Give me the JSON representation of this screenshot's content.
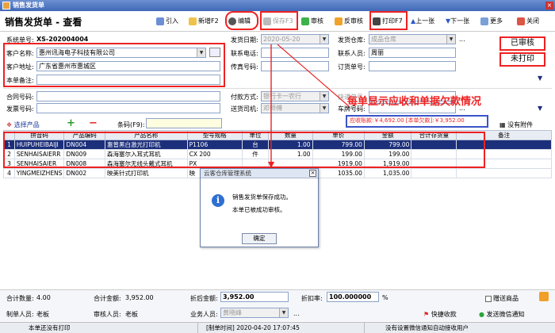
{
  "window": {
    "title": "销售发货单"
  },
  "header": {
    "page_title": "销售发货单 - 查看"
  },
  "toolbar": {
    "import": "引入",
    "new": "新增F2",
    "edit": "编辑",
    "save": "保存F3",
    "approve": "审核",
    "unapprove": "反审核",
    "print": "打印F7",
    "prev": "上一张",
    "next": "下一张",
    "more": "更多",
    "close": "关闭"
  },
  "form": {
    "sys_no_label": "系统单号:",
    "sys_no": "XS-202004004",
    "date_label": "发货日期:",
    "date": "2020-05-20",
    "warehouse_label": "发货仓库:",
    "warehouse": "成品仓库",
    "customer_label": "客户名称:",
    "customer": "惠州讯海电子科技有限公司",
    "contact_phone_label": "联系电话:",
    "contact_phone": "",
    "contact_label": "联系人员:",
    "contact": "周丽",
    "address_label": "客户地址:",
    "address": "广东省惠州市惠城区",
    "fax_label": "传真号码:",
    "fax": "",
    "order_label": "订货单号:",
    "order": "",
    "remark_label": "本单备注:",
    "remark": "",
    "contract_label": "合同号码:",
    "contract": "",
    "payment_label": "付款方式:",
    "payment": "银行卡一农行",
    "express_label": "快递单号:",
    "express": "",
    "invoice_label": "发票号码:",
    "invoice": "",
    "driver_label": "送货司机:",
    "driver": "邓师傅",
    "car_label": "车牌号码:",
    "car": ""
  },
  "status": {
    "approved": "已审核",
    "unprinted": "未打印"
  },
  "annotation": "每单显示应收和单据欠款情况",
  "receivable": "应收账款:￥4,692.00 [本单欠款]:￥3,952.00",
  "product_bar": {
    "select": "选择产品",
    "barcode_label": "条码(F9):",
    "barcode": "",
    "no_attach": "没有附件"
  },
  "table": {
    "headers": [
      "",
      "拼音码",
      "产品编码",
      "产品名称",
      "型号规格",
      "单位",
      "数量",
      "单价",
      "金额",
      "合计存货量",
      "备注"
    ],
    "rows": [
      [
        "1",
        "HUIPUHEIBAIJI",
        "DN004",
        "惠普黑白激光打印机",
        "P1106",
        "台",
        "1.00",
        "799.00",
        "799.00",
        "",
        ""
      ],
      [
        "2",
        "SENHAISAIERR",
        "DN009",
        "森海塞尔入耳式耳机",
        "CX 200",
        "件",
        "1.00",
        "199.00",
        "199.00",
        "",
        ""
      ],
      [
        "3",
        "SENHAISAIER",
        "DN008",
        "森海塞尔无线头戴式耳机",
        "PX",
        "",
        "",
        "1919.00",
        "1,919.00",
        "",
        ""
      ],
      [
        "4",
        "YINGMEIZHENS",
        "DN002",
        "映美针式打印机",
        "映",
        "",
        "",
        "1035.00",
        "1,035.00",
        "",
        ""
      ]
    ]
  },
  "dialog": {
    "title": "云客仓库管理系统",
    "line1": "销售发货单保存成功。",
    "line2": "本单已被成功审核。",
    "ok": "确定"
  },
  "totals": {
    "qty_label": "合计数量:",
    "qty": "4.00",
    "amount_label": "合计金额:",
    "amount": "3,952.00",
    "after_discount_label": "折后金额:",
    "after_discount": "3,952.00",
    "discount_label": "折扣率:",
    "discount": "100.000000",
    "pct": "%",
    "gift_label": "赠送商品"
  },
  "people": {
    "maker_label": "制单人员:",
    "maker": "老板",
    "auditor_label": "审核人员:",
    "auditor": "老板",
    "sales_label": "业务人员:",
    "sales": "黄晓峰",
    "quick_receive": "快捷收款",
    "wechat": "发送微信通知"
  },
  "statusbar": {
    "left": "本单还没有打印",
    "mid": "[制单时间] 2020-04-20 17:07:45",
    "right": "没有设置微信通知自动接收用户"
  },
  "colors": {
    "accent": "#e22222",
    "title_bar": "#3f68b8",
    "selected_row": "#1c2f7a",
    "receivable_border": "#3a55c8"
  }
}
